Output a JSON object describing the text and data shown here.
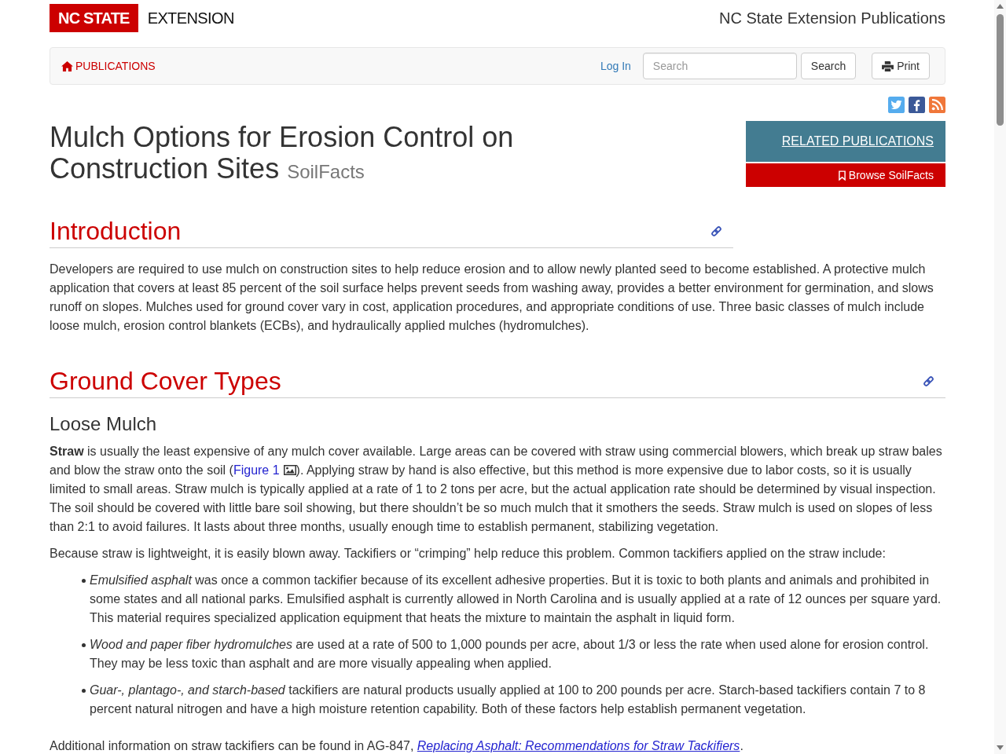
{
  "header": {
    "logo": "NC STATE",
    "logo_suffix": "EXTENSION",
    "site_title": "NC State Extension Publications"
  },
  "navbar": {
    "home_link": "PUBLICATIONS",
    "login": "Log In",
    "search": {
      "placeholder": "Search"
    },
    "search_button": "Search",
    "print_button": "Print"
  },
  "title": {
    "text": "Mulch Options for Erosion Control on Construction Sites",
    "series": "SoilFacts"
  },
  "related": {
    "heading": "RELATED PUBLICATIONS",
    "browse": "Browse SoilFacts"
  },
  "sections": [
    {
      "heading": "Introduction",
      "blocks": [
        {
          "kind": "paragraph",
          "segments": [
            {
              "kind": "text",
              "text": "Developers are required to use mulch on construction sites to help reduce erosion and to allow newly planted seed to become established. A protective mulch application that covers at least 85 percent of the soil surface helps prevent seeds from washing away, provides a better environment for germination, and slows runoff on slopes. Mulches used for ground cover vary in cost, application procedures, and appropriate conditions of use. Three basic classes of mulch include loose mulch, erosion control blankets (ECBs), and hydraulically applied mulches (hydromulches)."
            }
          ]
        }
      ]
    },
    {
      "heading": "Ground Cover Types",
      "blocks": [
        {
          "kind": "subheading",
          "text": "Loose Mulch"
        },
        {
          "kind": "paragraph",
          "segments": [
            {
              "kind": "text",
              "text": "**Straw** is usually the least expensive of any mulch cover available. Large areas can be covered with straw using commercial blowers, which break up straw bales and blow the straw onto the soil ("
            },
            {
              "kind": "figure_link",
              "text": "Figure 1"
            },
            {
              "kind": "text",
              "text": "). Applying straw by hand is also effective, but this method is more expensive due to labor costs, so it is usually limited to small areas. Straw mulch is typically applied at a rate of 1 to 2 tons per acre, but the actual application rate should be determined by visual inspection. The soil should be covered with little bare soil showing, but there shouldn’t be so much mulch that it smothers the seeds. Straw mulch is used on slopes of less than 2:1 to avoid failures. It lasts about three months, usually enough time to establish permanent, stabilizing vegetation."
            }
          ]
        },
        {
          "kind": "paragraph",
          "segments": [
            {
              "kind": "text",
              "text": "Because straw is lightweight, it is easily blown away. Tackifiers or “crimping” help reduce this problem. Common tackifiers applied on the straw include:"
            }
          ]
        },
        {
          "kind": "list",
          "items": [
            "*Emulsified asphalt* was once a common tackifier because of its excellent adhesive properties. But it is toxic to both plants and animals and prohibited in some states and all national parks. Emulsified asphalt is currently allowed in North Carolina and is usually applied at a rate of 12 ounces per square yard. This material requires specialized application equipment that heats the mixture to maintain the asphalt in liquid form.",
            "*Wood and paper fiber hydromulches* are used at a rate of 500 to 1,000 pounds per acre, about 1/3 or less the rate when used alone for erosion control. They may be less toxic than asphalt and are more visually appealing when applied.",
            "*Guar-, plantago-, and starch-based* tackifiers are natural products usually applied at 100 to 200 pounds per acre. Starch-based tackifiers contain 7 to 8 percent natural nitrogen and have a high moisture retention capability. Both of these factors help establish permanent vegetation."
          ]
        },
        {
          "kind": "paragraph",
          "segments": [
            {
              "kind": "text",
              "text": "Additional information on straw tackifiers can be found in AG-847, "
            },
            {
              "kind": "publication_link",
              "text": "Replacing Asphalt: Recommendations for Straw Tackifiers"
            },
            {
              "kind": "text",
              "text": "."
            }
          ]
        }
      ]
    }
  ]
}
